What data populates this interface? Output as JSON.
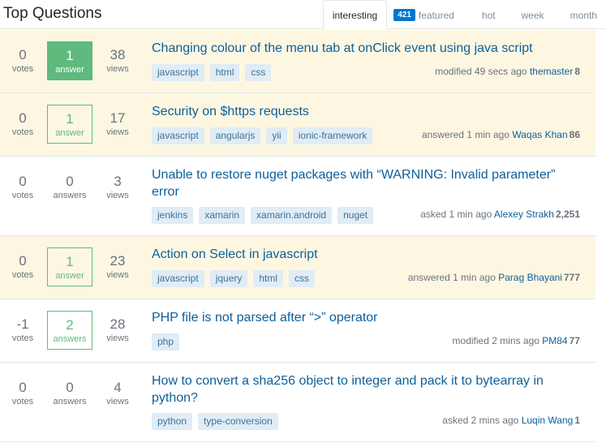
{
  "header": {
    "title": "Top Questions",
    "tabs": [
      {
        "label": "interesting",
        "active": true
      },
      {
        "label": "featured",
        "badge": "421"
      },
      {
        "label": "hot"
      },
      {
        "label": "week"
      },
      {
        "label": "month"
      }
    ]
  },
  "colors": {
    "accepted_answer": "#5eba7d",
    "highlight_row": "#fdf7e2",
    "link": "#0c5f9b",
    "tag_bg": "#e1ecf4",
    "tag_text": "#39739d",
    "badge": "#0077cc"
  },
  "questions": [
    {
      "votes": "0",
      "votes_label": "votes",
      "answers": "1",
      "answers_label": "answer",
      "answer_state": "accepted",
      "views": "38",
      "views_label": "views",
      "title": "Changing colour of the menu tab at onClick event using java script",
      "tags": [
        "javascript",
        "html",
        "css"
      ],
      "action": "modified 49 secs ago",
      "user": "themaster",
      "rep": "8",
      "highlighted": true
    },
    {
      "votes": "0",
      "votes_label": "votes",
      "answers": "1",
      "answers_label": "answer",
      "answer_state": "answered",
      "views": "17",
      "views_label": "views",
      "title": "Security on $https requests",
      "tags": [
        "javascript",
        "angularjs",
        "yii",
        "ionic-framework"
      ],
      "action": "answered 1 min ago",
      "user": "Waqas Khan",
      "rep": "86",
      "highlighted": true
    },
    {
      "votes": "0",
      "votes_label": "votes",
      "answers": "0",
      "answers_label": "answers",
      "answer_state": "none",
      "views": "3",
      "views_label": "views",
      "title": "Unable to restore nuget packages with “WARNING: Invalid parameter” error",
      "tags": [
        "jenkins",
        "xamarin",
        "xamarin.android",
        "nuget"
      ],
      "action": "asked 1 min ago",
      "user": "Alexey Strakh",
      "rep": "2,251",
      "highlighted": false
    },
    {
      "votes": "0",
      "votes_label": "votes",
      "answers": "1",
      "answers_label": "answer",
      "answer_state": "answered",
      "views": "23",
      "views_label": "views",
      "title": "Action on Select in javascript",
      "tags": [
        "javascript",
        "jquery",
        "html",
        "css"
      ],
      "action": "answered 1 min ago",
      "user": "Parag Bhayani",
      "rep": "777",
      "highlighted": true
    },
    {
      "votes": "-1",
      "votes_label": "votes",
      "answers": "2",
      "answers_label": "answers",
      "answer_state": "answered",
      "views": "28",
      "views_label": "views",
      "title": "PHP file is not parsed after “>” operator",
      "tags": [
        "php"
      ],
      "action": "modified 2 mins ago",
      "user": "PM84",
      "rep": "77",
      "highlighted": false
    },
    {
      "votes": "0",
      "votes_label": "votes",
      "answers": "0",
      "answers_label": "answers",
      "answer_state": "none",
      "views": "4",
      "views_label": "views",
      "title": "How to convert a sha256 object to integer and pack it to bytearray in python?",
      "tags": [
        "python",
        "type-conversion"
      ],
      "action": "asked 2 mins ago",
      "user": "Luqin Wang",
      "rep": "1",
      "highlighted": false
    }
  ]
}
